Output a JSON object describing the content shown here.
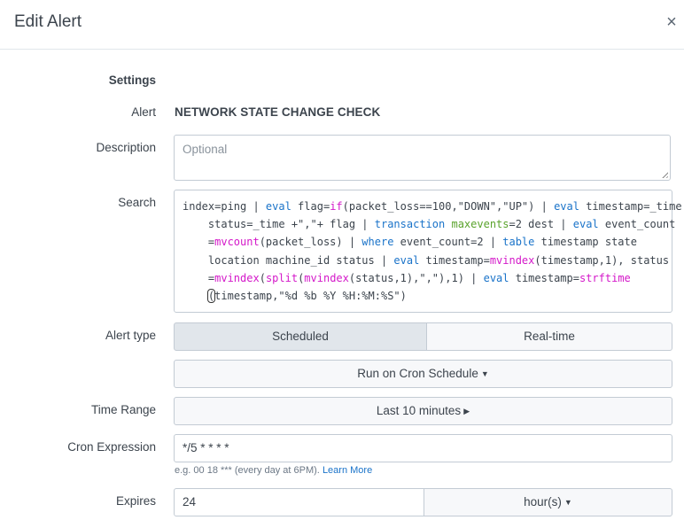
{
  "dialog": {
    "title": "Edit Alert",
    "close_icon": "close-icon",
    "close_glyph": "×"
  },
  "form": {
    "section_heading": "Settings",
    "alert": {
      "label": "Alert",
      "value": "NETWORK STATE CHANGE CHECK"
    },
    "description": {
      "label": "Description",
      "value": "",
      "placeholder": "Optional"
    },
    "search": {
      "label": "Search",
      "query": "index=ping | eval flag=if(packet_loss==100,\"DOWN\",\"UP\") | eval timestamp=_time, status=_time +\",\"+ flag | transaction maxevents=2 dest | eval event_count =mvcount(packet_loss) | where event_count=2 | table timestamp state location machine_id status | eval timestamp=mvindex(timestamp,1), status =mvindex(split(mvindex(status,1),\",\"),1) | eval timestamp=strftime (timestamp,\"%d %b %Y %H:%M:%S\")",
      "lines": [
        [
          {
            "t": "index=ping | ",
            "c": ""
          },
          {
            "t": "eval",
            "c": "kw"
          },
          {
            "t": " flag=",
            "c": ""
          },
          {
            "t": "if",
            "c": "fn"
          },
          {
            "t": "(packet_loss==100,\"DOWN\",\"UP\") | ",
            "c": ""
          },
          {
            "t": "eval",
            "c": "kw"
          },
          {
            "t": " timestamp=_time,",
            "c": ""
          }
        ],
        [
          {
            "t": "    status=_time +\",\"+ flag | ",
            "c": ""
          },
          {
            "t": "transaction",
            "c": "kw"
          },
          {
            "t": " ",
            "c": ""
          },
          {
            "t": "maxevents",
            "c": "arg"
          },
          {
            "t": "=2 dest | ",
            "c": ""
          },
          {
            "t": "eval",
            "c": "kw"
          },
          {
            "t": " event_count",
            "c": ""
          }
        ],
        [
          {
            "t": "    =",
            "c": ""
          },
          {
            "t": "mvcount",
            "c": "fn"
          },
          {
            "t": "(packet_loss) | ",
            "c": ""
          },
          {
            "t": "where",
            "c": "kw"
          },
          {
            "t": " event_count=2 | ",
            "c": ""
          },
          {
            "t": "table",
            "c": "kw"
          },
          {
            "t": " timestamp state",
            "c": ""
          }
        ],
        [
          {
            "t": "    location machine_id status | ",
            "c": ""
          },
          {
            "t": "eval",
            "c": "kw"
          },
          {
            "t": " timestamp=",
            "c": ""
          },
          {
            "t": "mvindex",
            "c": "fn"
          },
          {
            "t": "(timestamp,1), status",
            "c": ""
          }
        ],
        [
          {
            "t": "    =",
            "c": ""
          },
          {
            "t": "mvindex",
            "c": "fn"
          },
          {
            "t": "(",
            "c": ""
          },
          {
            "t": "split",
            "c": "fn"
          },
          {
            "t": "(",
            "c": ""
          },
          {
            "t": "mvindex",
            "c": "fn"
          },
          {
            "t": "(status,1),\",\"),1) | ",
            "c": ""
          },
          {
            "t": "eval",
            "c": "kw"
          },
          {
            "t": " timestamp=",
            "c": ""
          },
          {
            "t": "strftime",
            "c": "fn"
          }
        ],
        [
          {
            "t": "    ",
            "c": ""
          },
          {
            "t": "(",
            "c": "cursor"
          },
          {
            "t": "timestamp,\"%d %b %Y %H:%M:%S\")",
            "c": ""
          }
        ]
      ]
    },
    "alert_type": {
      "label": "Alert type",
      "options": [
        "Scheduled",
        "Real-time"
      ],
      "selected": "Scheduled"
    },
    "schedule": {
      "value": "Run on Cron Schedule",
      "caret_glyph": "▼"
    },
    "time_range": {
      "label": "Time Range",
      "value": "Last 10 minutes",
      "caret_glyph": "▶"
    },
    "cron": {
      "label": "Cron Expression",
      "value": "*/5 * * * *",
      "hint": "e.g. 00 18 *** (every day at 6PM).",
      "learn_more": "Learn More"
    },
    "expires": {
      "label": "Expires",
      "value": "24",
      "unit": "hour(s)",
      "caret_glyph": "▼"
    }
  },
  "colors": {
    "keyword": "#1a73c9",
    "function": "#d418c9",
    "argument": "#5aa32c",
    "selected_segment": "#e1e6eb",
    "link": "#1a73c9"
  }
}
